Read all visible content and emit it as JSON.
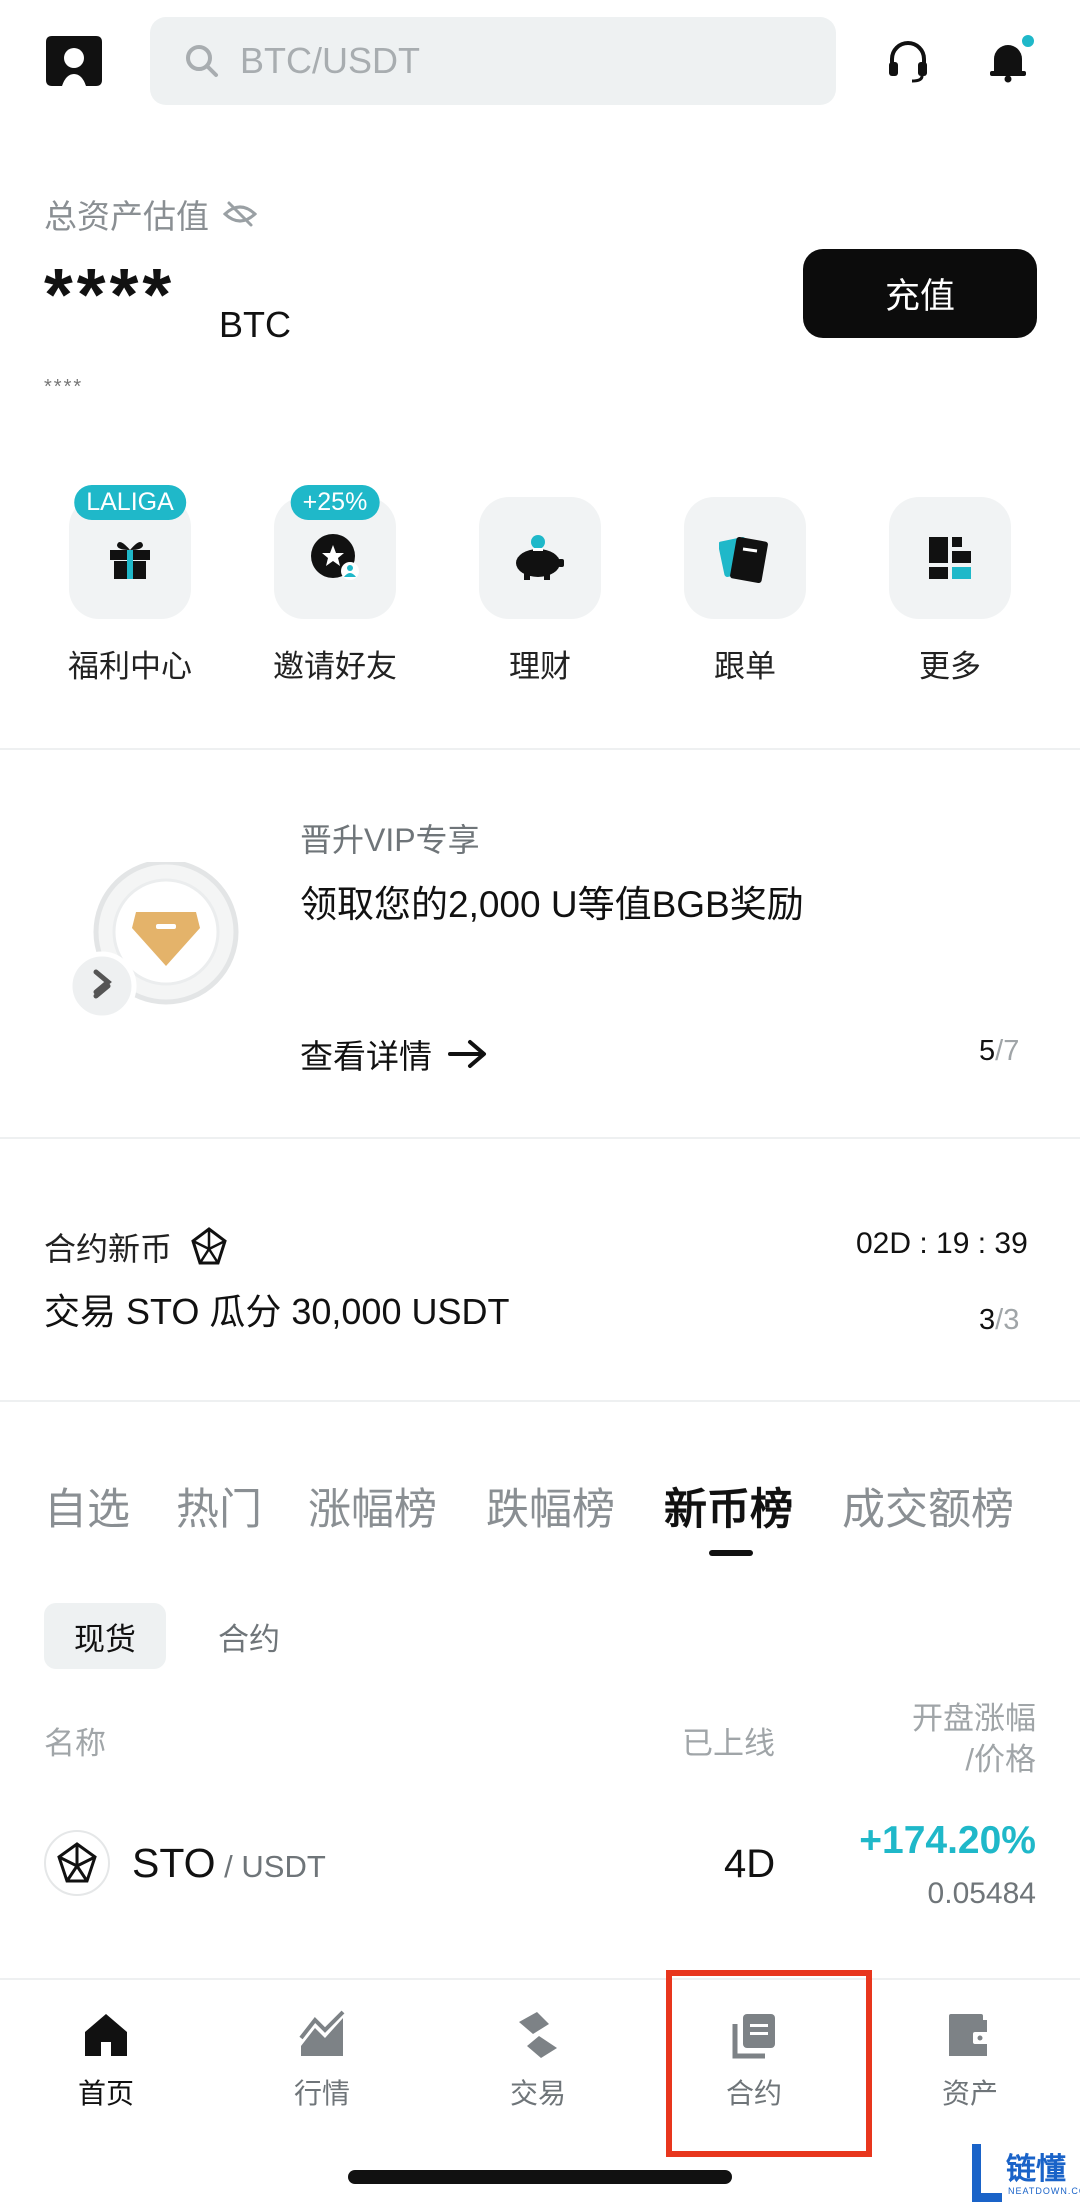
{
  "search": {
    "placeholder": "BTC/USDT"
  },
  "assets": {
    "label": "总资产估值",
    "value": "****",
    "unit": "BTC",
    "sub_value": "****",
    "deposit_label": "充值"
  },
  "quick_actions": [
    {
      "label": "福利中心",
      "badge": "LALIGA",
      "icon": "gift-icon"
    },
    {
      "label": "邀请好友",
      "badge": "+25%",
      "icon": "invite-icon"
    },
    {
      "label": "理财",
      "icon": "piggy-bank-icon"
    },
    {
      "label": "跟单",
      "icon": "copy-trade-icon"
    },
    {
      "label": "更多",
      "icon": "grid-icon"
    }
  ],
  "vip_banner": {
    "subtitle": "晋升VIP专享",
    "title": "领取您的2,000 U等值BGB奖励",
    "link_label": "查看详情",
    "page_current": "5",
    "page_total": "/7"
  },
  "new_contract": {
    "label": "合约新币",
    "title": "交易 STO 瓜分 30,000 USDT",
    "countdown": "02D : 19 : 39",
    "page_current": "3",
    "page_total": "/3"
  },
  "market_tabs": [
    {
      "label": "自选"
    },
    {
      "label": "热门"
    },
    {
      "label": "涨幅榜"
    },
    {
      "label": "跌幅榜"
    },
    {
      "label": "新币榜",
      "active": true
    },
    {
      "label": "成交额榜"
    }
  ],
  "segment": {
    "spot": "现货",
    "futures": "合约"
  },
  "table": {
    "headers": {
      "name": "名称",
      "online": "已上线",
      "change_line1": "开盘涨幅",
      "change_line2": "/价格"
    },
    "rows": [
      {
        "base": "STO",
        "quote": " / USDT",
        "online": "4D",
        "change": "+174.20%",
        "price": "0.05484"
      }
    ]
  },
  "nav": [
    {
      "label": "首页",
      "icon": "home-icon",
      "active": true
    },
    {
      "label": "行情",
      "icon": "market-icon"
    },
    {
      "label": "交易",
      "icon": "trade-icon"
    },
    {
      "label": "合约",
      "icon": "futures-icon"
    },
    {
      "label": "资产",
      "icon": "wallet-icon"
    }
  ],
  "watermark": {
    "main": "链懂",
    "sub": "NEATDOWN.COM"
  },
  "colors": {
    "accent": "#1fb8c9",
    "highlight": "#e8361d",
    "dark": "#0c0c0c"
  }
}
